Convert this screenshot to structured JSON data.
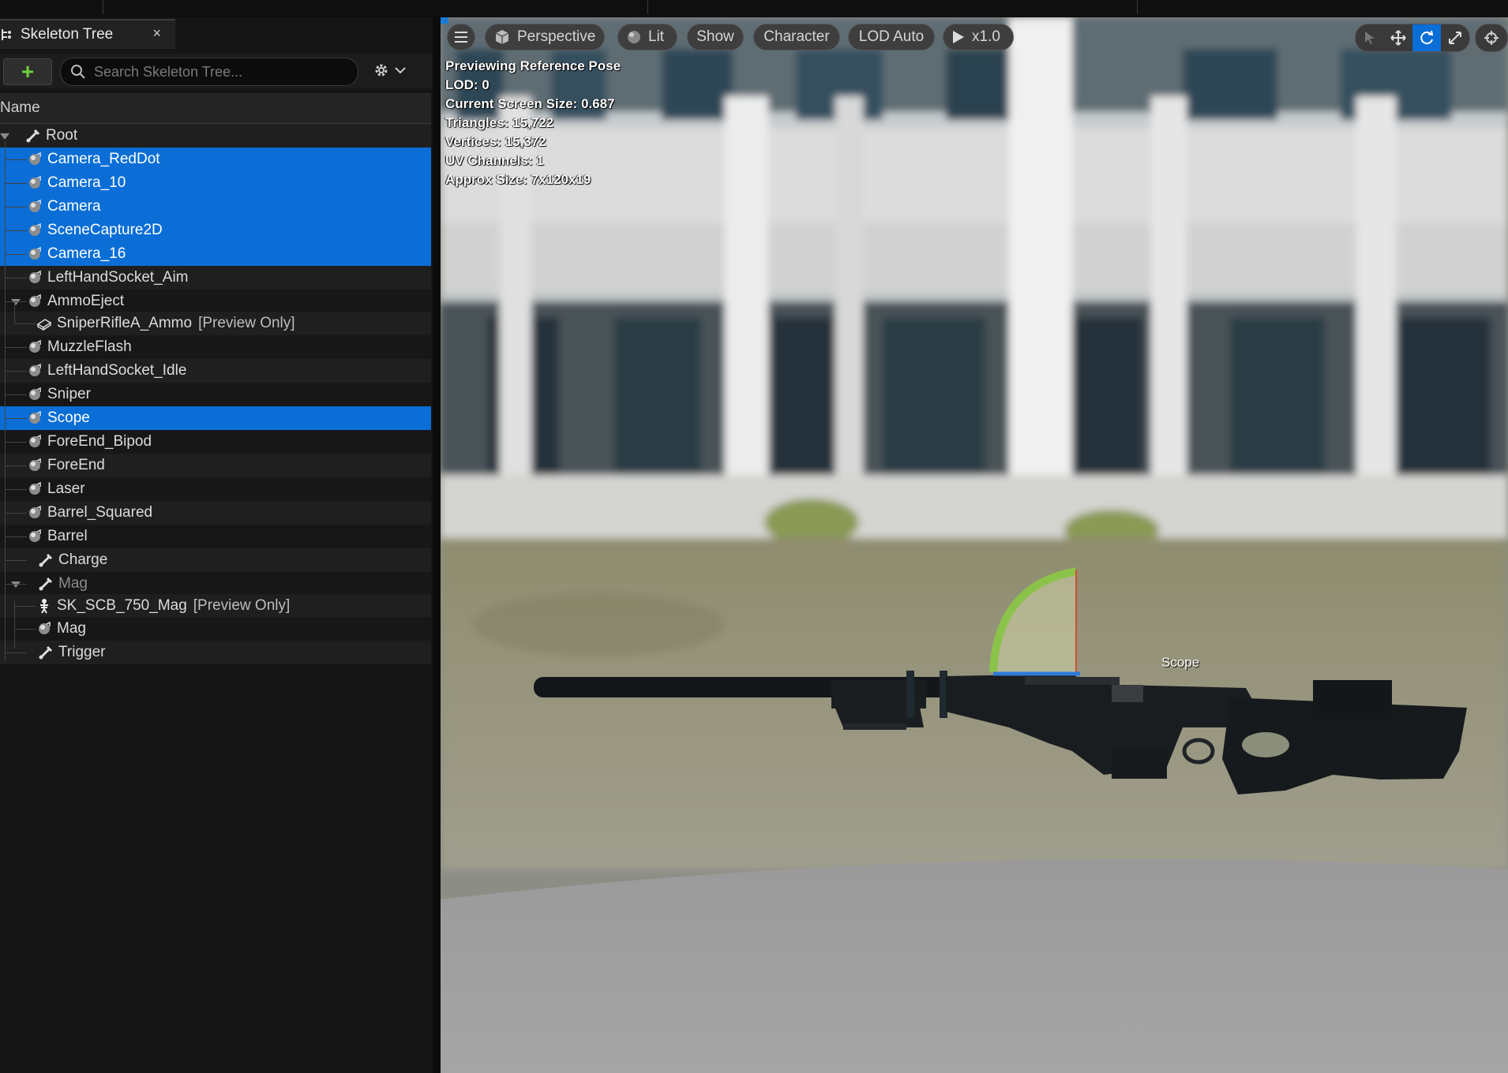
{
  "panel": {
    "tab_title": "Skeleton Tree",
    "close_glyph": "×",
    "add_glyph": "+",
    "search_placeholder": "Search Skeleton Tree...",
    "column_name": "Name"
  },
  "tree": [
    {
      "label": "Root",
      "icon": "bone-icon",
      "selected": false
    },
    {
      "label": "Camera_RedDot",
      "icon": "socket-icon",
      "selected": true
    },
    {
      "label": "Camera_10",
      "icon": "socket-icon",
      "selected": true
    },
    {
      "label": "Camera",
      "icon": "socket-icon",
      "selected": true
    },
    {
      "label": "SceneCapture2D",
      "icon": "socket-icon",
      "selected": true
    },
    {
      "label": "Camera_16",
      "icon": "socket-icon",
      "selected": true
    },
    {
      "label": "LeftHandSocket_Aim",
      "icon": "socket-icon",
      "selected": false
    },
    {
      "label": "AmmoEject",
      "icon": "socket-icon",
      "selected": false
    },
    {
      "label": "SniperRifleA_Ammo",
      "extra": "[Preview Only]",
      "icon": "mesh-icon",
      "selected": false
    },
    {
      "label": "MuzzleFlash",
      "icon": "socket-icon",
      "selected": false
    },
    {
      "label": "LeftHandSocket_Idle",
      "icon": "socket-icon",
      "selected": false
    },
    {
      "label": "Sniper",
      "icon": "socket-icon",
      "selected": false
    },
    {
      "label": "Scope",
      "icon": "socket-icon",
      "selected": true
    },
    {
      "label": "ForeEnd_Bipod",
      "icon": "socket-icon",
      "selected": false
    },
    {
      "label": "ForeEnd",
      "icon": "socket-icon",
      "selected": false
    },
    {
      "label": "Laser",
      "icon": "socket-icon",
      "selected": false
    },
    {
      "label": "Barrel_Squared",
      "icon": "socket-icon",
      "selected": false
    },
    {
      "label": "Barrel",
      "icon": "socket-icon",
      "selected": false
    },
    {
      "label": "Charge",
      "icon": "bone-icon",
      "selected": false
    },
    {
      "label": "Mag",
      "icon": "bone-icon",
      "selected": false,
      "dim": true
    },
    {
      "label": "SK_SCB_750_Mag",
      "extra": "[Preview Only]",
      "icon": "skeleton-icon",
      "selected": false
    },
    {
      "label": "Mag",
      "icon": "socket-icon",
      "selected": false
    },
    {
      "label": "Trigger",
      "icon": "bone-icon",
      "selected": false
    }
  ],
  "viewport": {
    "toolbar": {
      "perspective": "Perspective",
      "lit": "Lit",
      "show": "Show",
      "character": "Character",
      "lod": "LOD Auto",
      "speed": "x1.0"
    },
    "info": [
      "Previewing Reference Pose",
      "LOD: 0",
      "Current Screen Size: 0.687",
      "Triangles: 15,722",
      "Vertices: 15,372",
      "UV Channels: 1",
      "Approx Size: 7x120x19"
    ],
    "socket_label": "Scope"
  },
  "colors": {
    "selection": "#0a6ed6",
    "panel_bg": "#151515",
    "add_green": "#6fcf3f"
  }
}
